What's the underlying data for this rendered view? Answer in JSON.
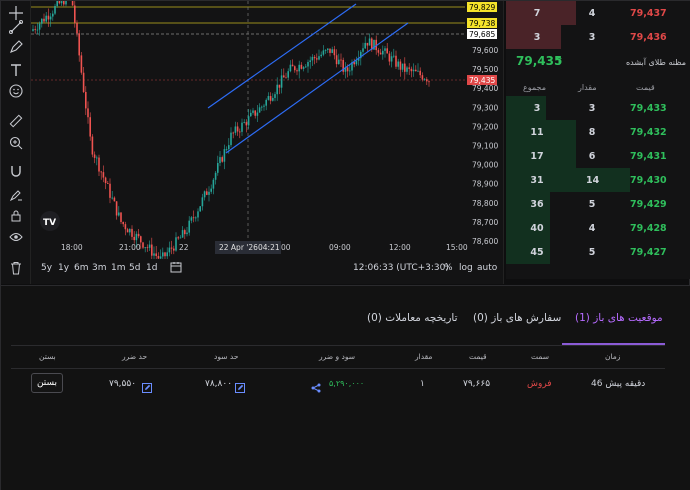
{
  "chart": {
    "ranges": [
      "5y",
      "1y",
      "6m",
      "3m",
      "1m",
      "5d",
      "1d"
    ],
    "clock": "12:06:33 (UTC+3:30)",
    "percent_label": "%",
    "log_label": "log",
    "auto_label": "auto",
    "crosshair_date": "22 Apr '26",
    "crosshair_time": "04:21",
    "x_labels": [
      "18:00",
      "21:00",
      "22",
      "00",
      "09:00",
      "12:00",
      "15:00"
    ],
    "y_labels": [
      "79,600",
      "79,500",
      "79,400",
      "79,300",
      "79,200",
      "79,100",
      "79,000",
      "78,900",
      "78,800",
      "78,700",
      "78,600"
    ],
    "price_tags": [
      {
        "text": "79,829",
        "color": "#f5e32a",
        "text_color": "#000000"
      },
      {
        "text": "79,738",
        "color": "#f5e32a",
        "text_color": "#000000"
      },
      {
        "text": "79,685",
        "color": "#ffffff",
        "text_color": "#000000"
      },
      {
        "text": "79,435",
        "color": "#e04848",
        "text_color": "#ffffff"
      }
    ],
    "logo_text": "TV"
  },
  "orderbook": {
    "asks": [
      {
        "total": "7",
        "qty": "4",
        "price": "79,437"
      },
      {
        "total": "3",
        "qty": "3",
        "price": "79,436"
      }
    ],
    "mid_price": "79,435",
    "mid_arrow": "↑",
    "mid_label": "مظنه طلای آبشده",
    "headers": {
      "total": "مجموع",
      "qty": "مقدار",
      "price": "قیمت"
    },
    "bids": [
      {
        "total": "3",
        "qty": "3",
        "price": "79,433"
      },
      {
        "total": "11",
        "qty": "8",
        "price": "79,432"
      },
      {
        "total": "17",
        "qty": "6",
        "price": "79,431"
      },
      {
        "total": "31",
        "qty": "14",
        "price": "79,430"
      },
      {
        "total": "36",
        "qty": "5",
        "price": "79,429"
      },
      {
        "total": "40",
        "qty": "4",
        "price": "79,428"
      },
      {
        "total": "45",
        "qty": "5",
        "price": "79,427"
      }
    ]
  },
  "tabs": {
    "positions": "موقعیت های باز (1)",
    "orders": "سفارش های باز (0)",
    "history": "تاریخچه معاملات (0)"
  },
  "table": {
    "headers": {
      "time": "زمان",
      "side": "سمت",
      "price": "قیمت",
      "amount": "مقدار",
      "pnl": "سود و ضرر",
      "tp": "حد سود",
      "sl": "حد ضرر",
      "close": "بستن"
    },
    "row": {
      "time": "46 دقیقه پیش",
      "side": "فروش",
      "price": "۷۹,۶۶۵",
      "amount": "۱",
      "pnl": "۵,۲۹۰,۰۰۰",
      "tp": "۷۸,۸۰۰",
      "sl": "۷۹,۵۵۰",
      "close_label": "بستن"
    }
  }
}
